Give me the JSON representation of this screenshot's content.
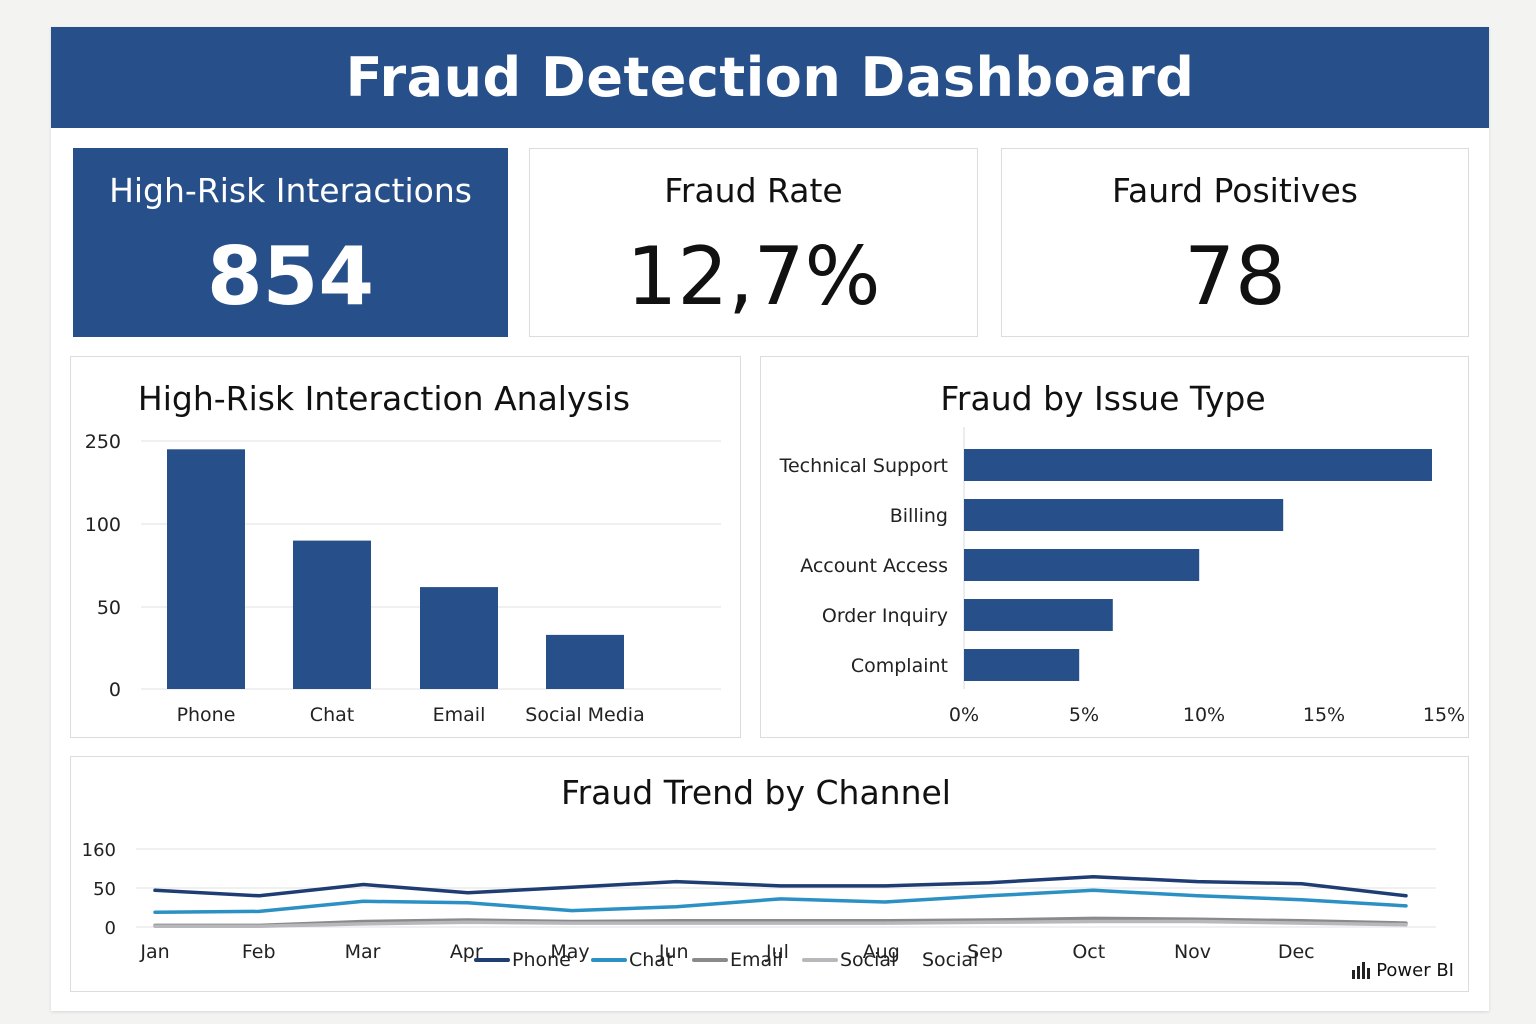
{
  "header": {
    "title": "Fraud Detection Dashboard"
  },
  "kpis": [
    {
      "label": "High-Risk Interactions",
      "value": "854"
    },
    {
      "label": "Fraud Rate",
      "value": "12,7%"
    },
    {
      "label": "Faurd Positives",
      "value": "78"
    }
  ],
  "branding": {
    "label": "Power BI",
    "icon": "power-bi-icon"
  },
  "colors": {
    "primary": "#27508b",
    "chat": "#2b91c4",
    "email": "#8a8a8a",
    "social": "#b8b8bc",
    "grid": "#e2e2e2"
  },
  "chart_data": [
    {
      "id": "channel-bars",
      "type": "bar",
      "title": "High-Risk Interaction Analysis",
      "categories": [
        "Phone",
        "Chat",
        "Email",
        "Social Media"
      ],
      "values": [
        235,
        90,
        62,
        33
      ],
      "y_ticks": [
        "0",
        "50",
        "100",
        "250"
      ],
      "y_tick_values": [
        0,
        50,
        100,
        250
      ],
      "grid": true
    },
    {
      "id": "issue-bars",
      "type": "bar",
      "orientation": "horizontal",
      "title": "Fraud by Issue Type",
      "categories": [
        "Technical Support",
        "Billing",
        "Account Access",
        "Order Inquiry",
        "Complaint"
      ],
      "values": [
        19.5,
        13.3,
        9.8,
        6.2,
        4.8
      ],
      "x_ticks": [
        "0%",
        "5%",
        "10%",
        "15%",
        "15%"
      ],
      "x_tick_values": [
        0,
        5,
        10,
        15,
        20
      ],
      "grid": false
    },
    {
      "id": "trend-lines",
      "type": "line",
      "title": "Fraud Trend by Channel",
      "x": [
        "Jan",
        "Feb",
        "Mar",
        "Apr",
        "May",
        "Jun",
        "Jul",
        "Aug",
        "Sep",
        "Oct",
        "Nov",
        "Dec"
      ],
      "y_ticks": [
        "0",
        "50",
        "160"
      ],
      "y_tick_values": [
        0,
        50,
        160
      ],
      "grid": true,
      "legend_position": "bottom",
      "series": [
        {
          "name": "Phone",
          "color": "#1f3d73",
          "values": [
            47,
            40,
            60,
            44,
            52,
            68,
            56,
            56,
            65,
            82,
            68,
            62,
            40
          ]
        },
        {
          "name": "Chat",
          "color": "#2b91c4",
          "values": [
            19,
            20,
            33,
            31,
            21,
            26,
            36,
            32,
            40,
            47,
            40,
            35,
            27
          ]
        },
        {
          "name": "Email",
          "color": "#8a8a8a",
          "values": [
            2,
            2,
            7,
            9,
            7,
            8,
            8,
            8,
            9,
            11,
            10,
            8,
            5
          ]
        },
        {
          "name": "Social",
          "color": "#b8b8bc",
          "values": [
            1,
            1,
            4,
            6,
            5,
            5,
            5,
            5,
            6,
            7,
            7,
            5,
            3
          ]
        }
      ],
      "legend_extra": "Social"
    }
  ]
}
